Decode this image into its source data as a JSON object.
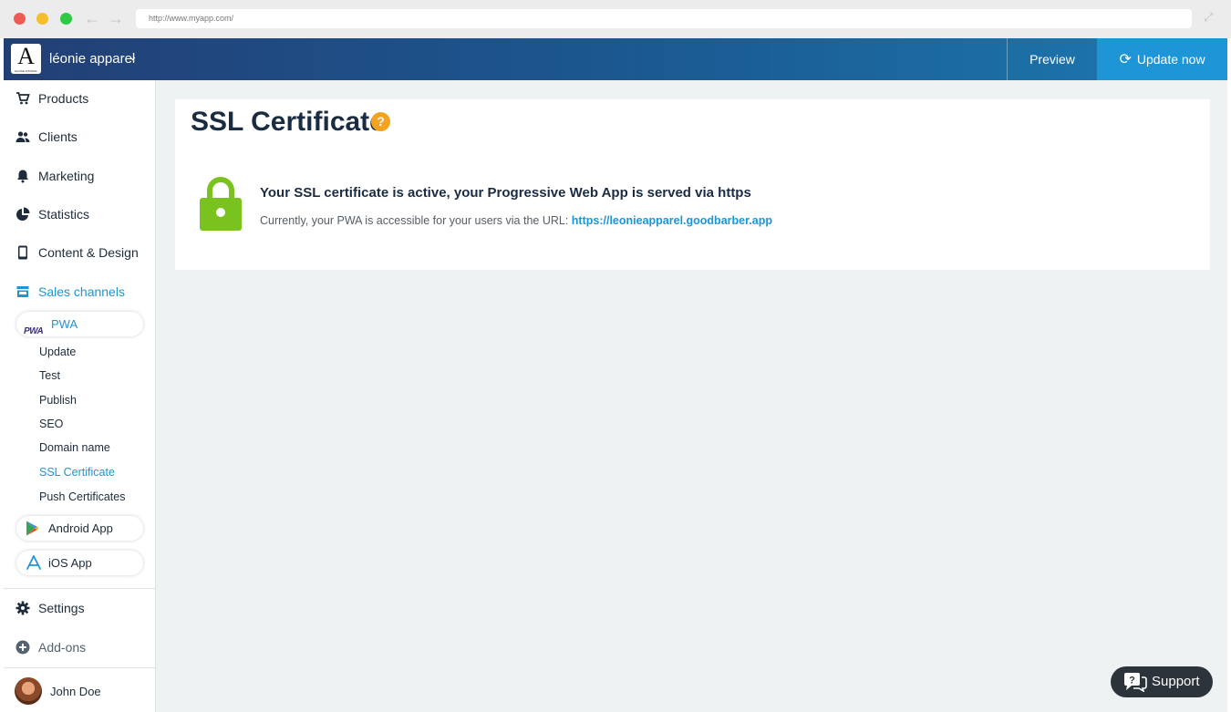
{
  "browser": {
    "url": "http://www.myapp.com/"
  },
  "header": {
    "logo_letter": "A",
    "logo_subtext": "LEONIE APPAREL",
    "store_name": "léonie apparel",
    "preview_label": "Preview",
    "update_label": "Update now"
  },
  "sidebar": {
    "items": [
      {
        "label": "Products",
        "icon": "cart-icon"
      },
      {
        "label": "Clients",
        "icon": "users-icon"
      },
      {
        "label": "Marketing",
        "icon": "bell-icon"
      },
      {
        "label": "Statistics",
        "icon": "pie-chart-icon"
      },
      {
        "label": "Content & Design",
        "icon": "phone-icon"
      },
      {
        "label": "Sales channels",
        "icon": "store-icon"
      }
    ],
    "pwa": {
      "logo_text": "PWA",
      "label": "PWA",
      "sub_items": [
        "Update",
        "Test",
        "Publish",
        "SEO",
        "Domain name",
        "SSL Certificate",
        "Push Certificates"
      ],
      "active_sub_item": "SSL Certificate"
    },
    "android_label": "Android App",
    "ios_label": "iOS App",
    "settings_label": "Settings",
    "addons_label": "Add-ons",
    "user_name": "John Doe"
  },
  "main": {
    "title": "SSL Certificate",
    "help_glyph": "?",
    "heading": "Your SSL certificate is active, your Progressive Web App is served via https",
    "text_prefix": "Currently, your PWA is accessible for your users via the URL:",
    "url": "https://leonieapparel.goodbarber.app"
  },
  "support": {
    "label": "Support"
  },
  "colors": {
    "accent": "#1d95d6",
    "lock_green": "#7ac31e",
    "help_orange": "#f3a320",
    "header_dark": "#223f75"
  }
}
